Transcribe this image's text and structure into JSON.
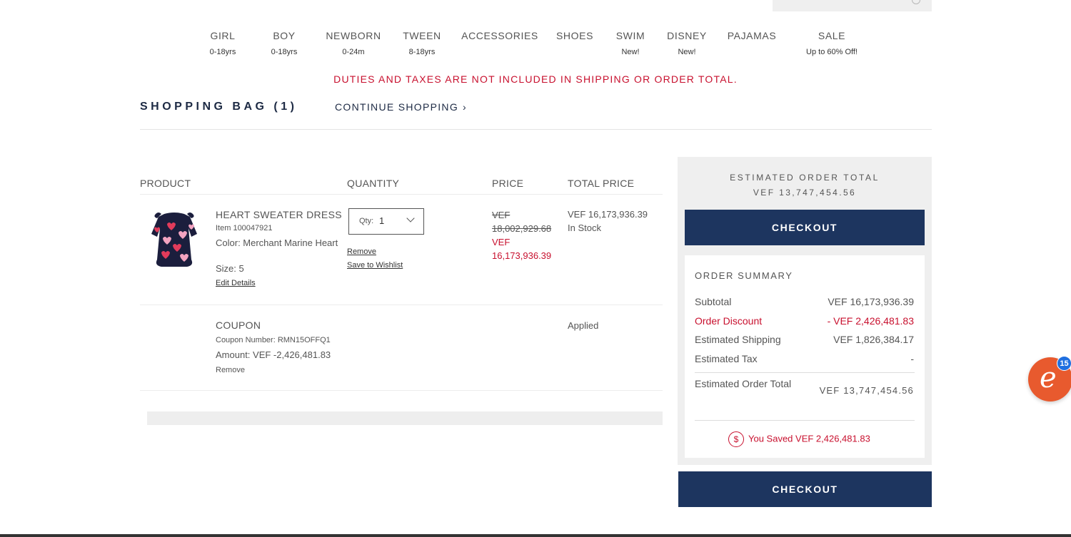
{
  "nav": [
    {
      "label": "GIRL",
      "sub": "0-18yrs"
    },
    {
      "label": "BOY",
      "sub": "0-18yrs"
    },
    {
      "label": "NEWBORN",
      "sub": "0-24m"
    },
    {
      "label": "TWEEN",
      "sub": "8-18yrs"
    },
    {
      "label": "ACCESSORIES",
      "sub": ""
    },
    {
      "label": "SHOES",
      "sub": ""
    },
    {
      "label": "SWIM",
      "sub": "New!"
    },
    {
      "label": "DISNEY",
      "sub": "New!"
    },
    {
      "label": "PAJAMAS",
      "sub": ""
    },
    {
      "label": "SALE",
      "sub": "Up to 60% Off!"
    }
  ],
  "notice": "DUTIES AND TAXES ARE NOT INCLUDED IN SHIPPING OR ORDER TOTAL.",
  "bag": {
    "title": "SHOPPING BAG (1)",
    "continue_label": "CONTINUE SHOPPING",
    "columns": [
      "PRODUCT",
      "QUANTITY",
      "PRICE",
      "TOTAL PRICE"
    ]
  },
  "item": {
    "name": "HEART SWEATER DRESS",
    "item_number": "Item 100047921",
    "color": "Color: Merchant Marine Heart",
    "size": "Size: 5",
    "edit_label": "Edit Details",
    "qty_label": "Qty:",
    "qty_value": "1",
    "remove_label": "Remove",
    "wishlist_label": "Save to Wishlist",
    "price_original": "VEF 18,002,929.68",
    "price_sale": "VEF 16,173,936.39",
    "total_price": "VEF 16,173,936.39",
    "stock": "In Stock"
  },
  "coupon": {
    "title": "COUPON",
    "number": "Coupon Number: RMN15OFFQ1",
    "amount": "Amount: VEF -2,426,481.83",
    "remove_label": "Remove",
    "status": "Applied"
  },
  "summary": {
    "estimated_label": "ESTIMATED ORDER TOTAL",
    "estimated_value": "VEF 13,747,454.56",
    "checkout_label": "CHECKOUT",
    "title": "ORDER SUMMARY",
    "subtotal_label": "Subtotal",
    "subtotal_value": "VEF 16,173,936.39",
    "discount_label": "Order Discount",
    "discount_value": "- VEF 2,426,481.83",
    "shipping_label": "Estimated Shipping",
    "shipping_value": "VEF 1,826,384.17",
    "tax_label": "Estimated Tax",
    "tax_value": "-",
    "total_label": "Estimated Order Total",
    "total_value": "VEF 13,747,454.56",
    "saved_text": "You Saved VEF 2,426,481.83",
    "saved_icon": "$"
  },
  "chat": {
    "icon": "chat-widget-icon",
    "glyph": "e",
    "badge_count": "15"
  },
  "colors": {
    "brand_navy": "#1d355f",
    "accent_red": "#c8102e",
    "chat_orange": "#e85a2e",
    "badge_blue": "#1f6fe0"
  }
}
